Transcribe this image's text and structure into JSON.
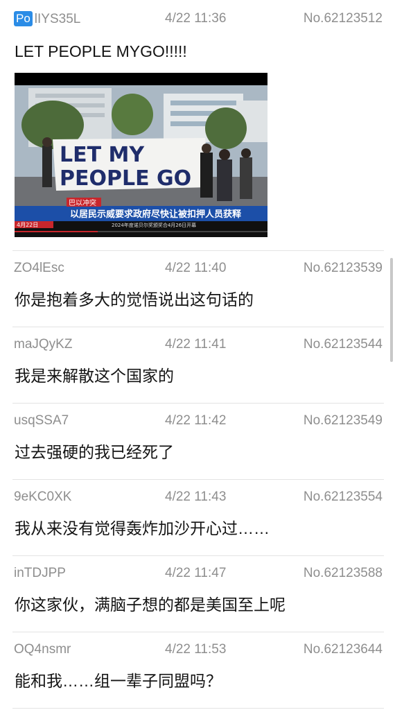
{
  "posts": [
    {
      "po": "Po",
      "uid": "lIYS35L",
      "time": "4/22 11:36",
      "no": "No.62123512",
      "content": "LET PEOPLE MYGO!!!!!"
    },
    {
      "uid": "ZO4lEsc",
      "time": "4/22 11:40",
      "no": "No.62123539",
      "content": "你是抱着多大的觉悟说出这句话的"
    },
    {
      "uid": "maJQyKZ",
      "time": "4/22 11:41",
      "no": "No.62123544",
      "content": "我是来解散这个国家的"
    },
    {
      "uid": "usqSSA7",
      "time": "4/22 11:42",
      "no": "No.62123549",
      "content": "过去强硬的我已经死了"
    },
    {
      "uid": "9eKC0XK",
      "time": "4/22 11:43",
      "no": "No.62123554",
      "content": "我从来没有觉得轰炸加沙开心过……"
    },
    {
      "uid": "inTDJPP",
      "time": "4/22 11:47",
      "no": "No.62123588",
      "content": "你这家伙，满脑子想的都是美国至上呢"
    },
    {
      "uid": "OQ4nsmr",
      "time": "4/22 11:53",
      "no": "No.62123644",
      "content": "能和我……组一辈子同盟吗？"
    }
  ],
  "image": {
    "banner_line1": "LET MY",
    "banner_line2": "PEOPLE GO",
    "caption_tag": "巴以冲突",
    "caption_main": "以居民示威要求政府尽快让被扣押人员获释",
    "ticker_date": "4月22日",
    "ticker_text": "2024年度诺贝尔奖颁奖合4月26日开幕"
  },
  "colors": {
    "po_badge": "#2b8ce6",
    "meta_gray": "#8e8e8e",
    "caption_blue": "#1c4fa8",
    "ticker_red": "#c8262c"
  }
}
